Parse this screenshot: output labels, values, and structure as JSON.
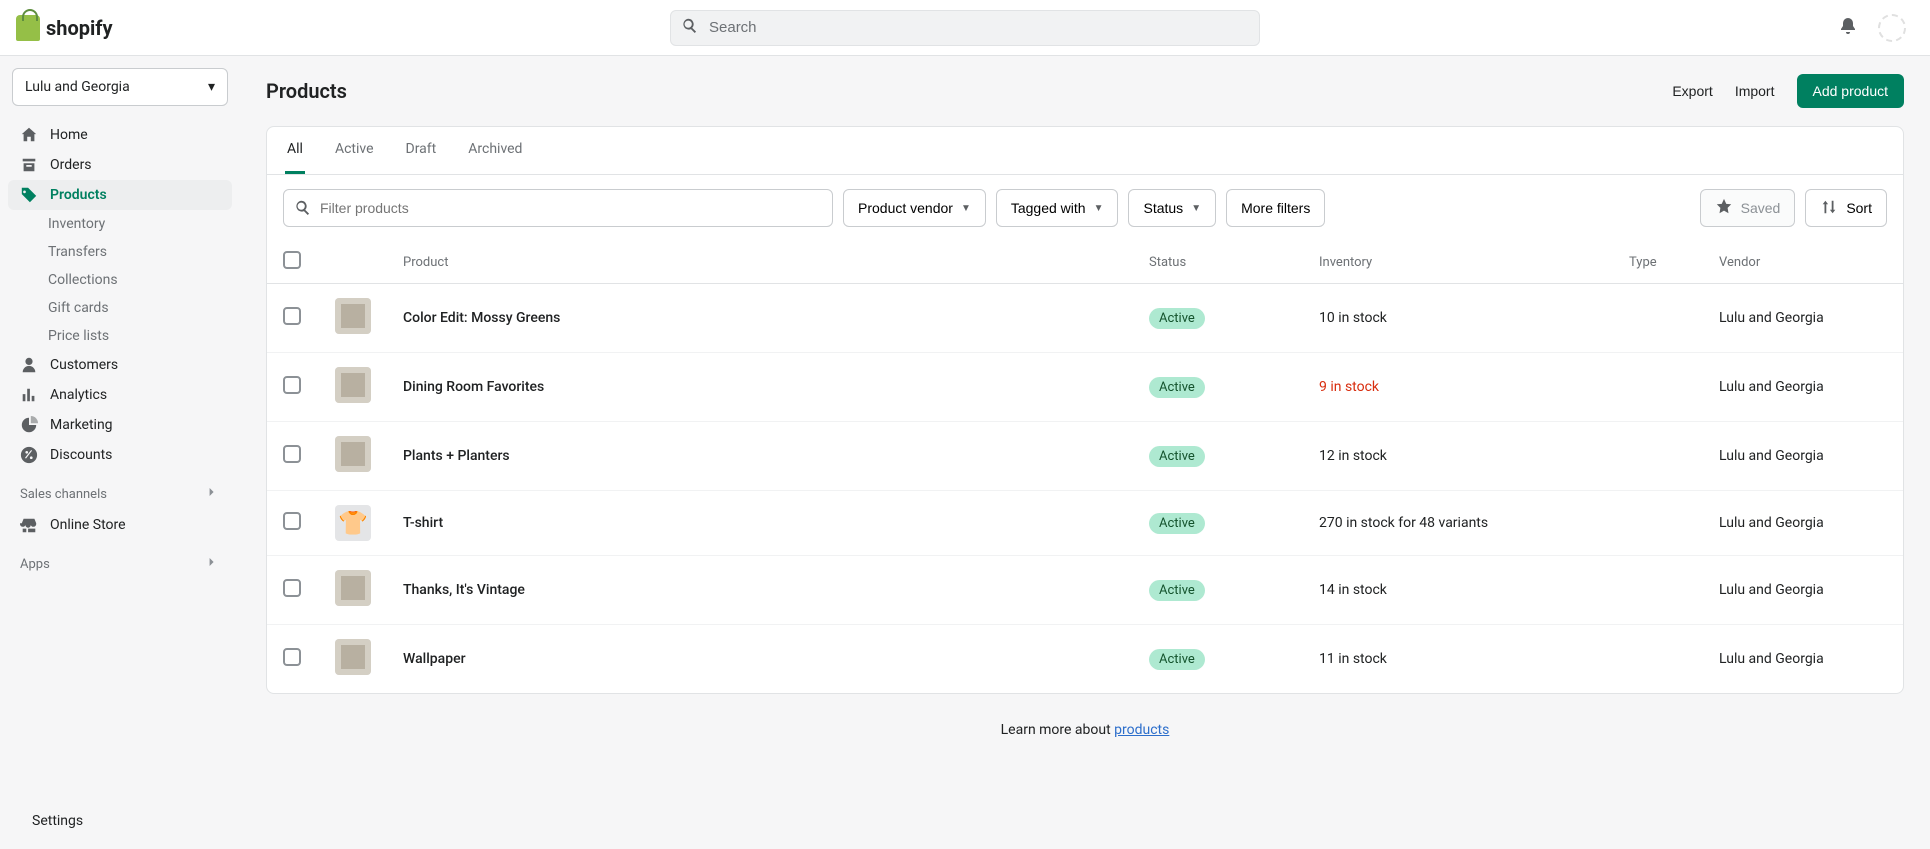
{
  "brand": "shopify",
  "search": {
    "placeholder": "Search"
  },
  "user_name": "",
  "store_name": "Lulu and Georgia",
  "sidebar": {
    "items": [
      {
        "label": "Home",
        "icon": "home"
      },
      {
        "label": "Orders",
        "icon": "orders"
      },
      {
        "label": "Products",
        "icon": "products",
        "selected": true
      },
      {
        "label": "Inventory",
        "sub": true
      },
      {
        "label": "Transfers",
        "sub": true
      },
      {
        "label": "Collections",
        "sub": true
      },
      {
        "label": "Gift cards",
        "sub": true
      },
      {
        "label": "Price lists",
        "sub": true
      },
      {
        "label": "Customers",
        "icon": "customers"
      },
      {
        "label": "Analytics",
        "icon": "analytics"
      },
      {
        "label": "Marketing",
        "icon": "marketing"
      },
      {
        "label": "Discounts",
        "icon": "discounts"
      }
    ],
    "section_sales": "Sales channels",
    "online_store": "Online Store",
    "section_apps": "Apps",
    "settings": "Settings"
  },
  "page": {
    "title": "Products",
    "export": "Export",
    "import": "Import",
    "add": "Add product"
  },
  "tabs": [
    "All",
    "Active",
    "Draft",
    "Archived"
  ],
  "active_tab": 0,
  "filters": {
    "placeholder": "Filter products",
    "vendor": "Product vendor",
    "tagged": "Tagged with",
    "status": "Status",
    "more": "More filters",
    "saved": "Saved",
    "sort": "Sort"
  },
  "table": {
    "headers": {
      "product": "Product",
      "status": "Status",
      "inventory": "Inventory",
      "type": "Type",
      "vendor": "Vendor"
    },
    "rows": [
      {
        "name": "Color Edit: Mossy Greens",
        "status": "Active",
        "inventory": "10 in stock",
        "low": false,
        "type": "",
        "vendor": "Lulu and Georgia",
        "thumb": "room"
      },
      {
        "name": "Dining Room Favorites",
        "status": "Active",
        "inventory": "9 in stock",
        "low": true,
        "type": "",
        "vendor": "Lulu and Georgia",
        "thumb": "room"
      },
      {
        "name": "Plants + Planters",
        "status": "Active",
        "inventory": "12 in stock",
        "low": false,
        "type": "",
        "vendor": "Lulu and Georgia",
        "thumb": "room"
      },
      {
        "name": "T-shirt",
        "status": "Active",
        "inventory": "270 in stock for 48 variants",
        "low": false,
        "type": "",
        "vendor": "Lulu and Georgia",
        "thumb": "tee"
      },
      {
        "name": "Thanks, It's Vintage",
        "status": "Active",
        "inventory": "14 in stock",
        "low": false,
        "type": "",
        "vendor": "Lulu and Georgia",
        "thumb": "room"
      },
      {
        "name": "Wallpaper",
        "status": "Active",
        "inventory": "11 in stock",
        "low": false,
        "type": "",
        "vendor": "Lulu and Georgia",
        "thumb": "room"
      }
    ]
  },
  "footer": {
    "text": "Learn more about ",
    "link": "products"
  }
}
